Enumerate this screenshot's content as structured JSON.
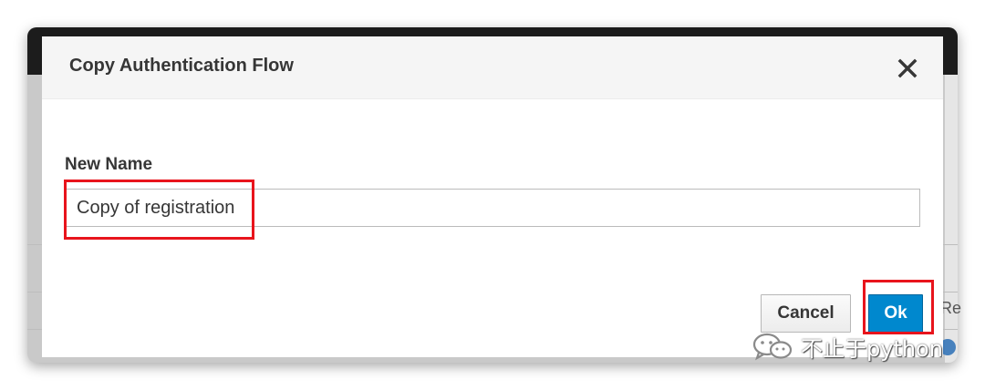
{
  "modal": {
    "title": "Copy Authentication Flow",
    "field_label": "New Name",
    "input_value": "Copy of registration",
    "cancel_label": "Cancel",
    "ok_label": "Ok"
  },
  "background": {
    "peek_text": "Re"
  },
  "watermark": {
    "text": "不止于python"
  },
  "icons": {
    "close": "close-icon",
    "watermark": "wechat-icon"
  },
  "colors": {
    "primary": "#0088ce",
    "highlight": "#e8141c",
    "header_bg": "#f5f5f5"
  }
}
